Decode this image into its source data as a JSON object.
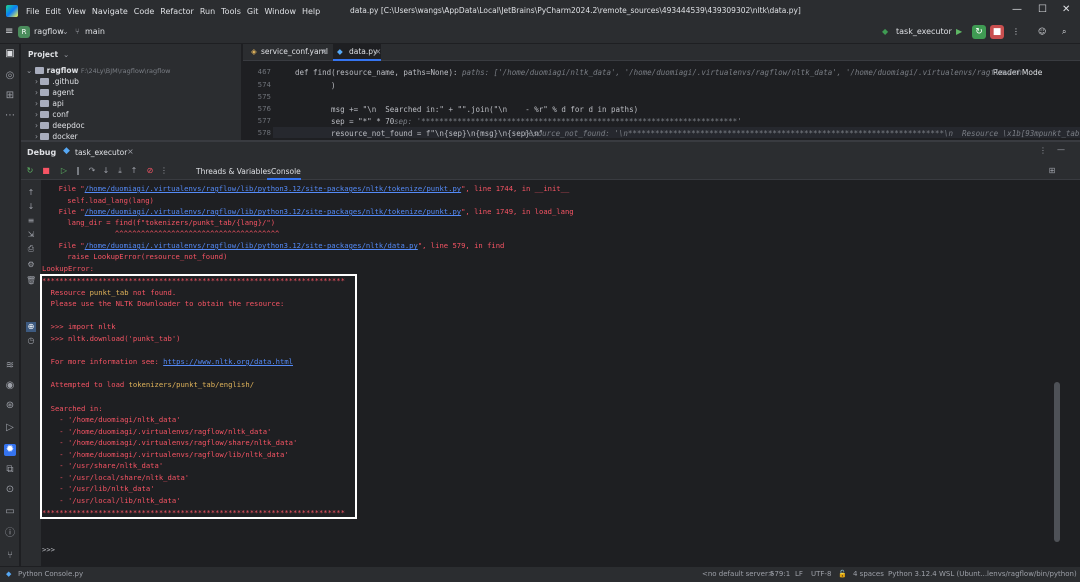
{
  "menu": [
    "File",
    "Edit",
    "View",
    "Navigate",
    "Code",
    "Refactor",
    "Run",
    "Tools",
    "Git",
    "Window",
    "Help"
  ],
  "window_title": "data.py [C:\\Users\\wangs\\AppData\\Local\\JetBrains\\PyCharm2024.2\\remote_sources\\493444539\\439309302\\nltk\\data.py]",
  "toolbar": {
    "project_name": "ragflow",
    "branch": "main",
    "run_config": "task_executor"
  },
  "project_pane": {
    "title": "Project",
    "root": "ragflow",
    "root_path": "F:\\24Ly\\BJM\\ragflow\\ragflow",
    "items": [
      ".github",
      "agent",
      "api",
      "conf",
      "deepdoc",
      "docker"
    ]
  },
  "editor": {
    "tabs": [
      "service_conf.yaml",
      "data.py"
    ],
    "reader_mode": "Reader Mode",
    "lines": [
      {
        "num": "467",
        "code": "def find(resource_name, paths=None):",
        "hint": "  paths: ['/home/duomiagi/nltk_data', '/home/duomiagi/.virtualenvs/ragflow/nltk_data', '/home/duomiagi/.virtualenvs/ragflow/sh"
      },
      {
        "num": "574",
        "code": "    )",
        "hint": ""
      },
      {
        "num": "575",
        "code": "",
        "hint": ""
      },
      {
        "num": "576",
        "code": "    msg += \"\\n  Searched in:\" + \"\".join(\"\\n    - %r\" % d for d in paths)",
        "hint": ""
      },
      {
        "num": "577",
        "code": "    sep = \"*\" * 70",
        "hint": "  sep: '**********************************************************************'"
      },
      {
        "num": "578",
        "code": "    resource_not_found = f\"\\n{sep}\\n{msg}\\n{sep}\\n\"",
        "hint": "  resource_not_found: '\\n**********************************************************************\\n  Resource \\x1b[93mpunkt_tab\\x1b"
      }
    ]
  },
  "debug": {
    "label": "Debug",
    "session": "task_executor",
    "tabs": [
      "Threads & Variables",
      "Console"
    ]
  },
  "console": {
    "trace": [
      {
        "pre": "  File \"",
        "link": "/home/duomiagi/.virtualenvs/ragflow/lib/python3.12/site-packages/nltk/tokenize/punkt.py",
        "post": "\", line 1744, in __init__"
      },
      {
        "pre": "    self.load_lang(lang)",
        "link": "",
        "post": ""
      },
      {
        "pre": "  File \"",
        "link": "/home/duomiagi/.virtualenvs/ragflow/lib/python3.12/site-packages/nltk/tokenize/punkt.py",
        "post": "\", line 1749, in load_lang"
      },
      {
        "pre": "    lang_dir = find(f\"tokenizers/punkt_tab/{lang}/\")",
        "link": "",
        "post": ""
      },
      {
        "pre": "               ^^^^^^^^^^^^^^^^^^^^^^^^^^^^^^^^^^^^^^",
        "link": "",
        "post": ""
      },
      {
        "pre": "  File \"",
        "link": "/home/duomiagi/.virtualenvs/ragflow/lib/python3.12/site-packages/nltk/data.py",
        "post": "\", line 579, in find"
      },
      {
        "pre": "    raise LookupError(resource_not_found)",
        "link": "",
        "post": ""
      },
      {
        "pre": "LookupError:",
        "link": "",
        "post": ""
      }
    ],
    "sep": "**********************************************************************",
    "resource_pre": "  Resource ",
    "resource_name": "punkt_tab",
    "resource_post": " not found.",
    "downloader_msg": "  Please use the NLTK Downloader to obtain the resource:",
    "import_line": "  >>> import nltk",
    "download_line": "  >>> nltk.download('punkt_tab')",
    "info_pre": "  For more information see: ",
    "info_link": "https://www.nltk.org/data.html",
    "attempted_pre": "  Attempted to load ",
    "attempted_path": "tokenizers/punkt_tab/english/",
    "searched_in": "  Searched in:",
    "paths": [
      "    - '/home/duomiagi/nltk_data'",
      "    - '/home/duomiagi/.virtualenvs/ragflow/nltk_data'",
      "    - '/home/duomiagi/.virtualenvs/ragflow/share/nltk_data'",
      "    - '/home/duomiagi/.virtualenvs/ragflow/lib/nltk_data'",
      "    - '/usr/share/nltk_data'",
      "    - '/usr/local/share/nltk_data'",
      "    - '/usr/lib/nltk_data'",
      "    - '/usr/local/lib/nltk_data'"
    ],
    "prompt": ">>>"
  },
  "statusbar": {
    "left": "Python Console.py",
    "server": "<no default server>",
    "position": "579:1",
    "line_sep": "LF",
    "encoding": "UTF-8",
    "indent": "4 spaces",
    "interpreter": "Python 3.12.4 WSL (Ubunt...lenvs/ragflow/bin/python)"
  },
  "colors": {
    "error": "#f75464",
    "link": "#548af7",
    "run_green": "#3f9b53",
    "stop_red": "#c94f4f"
  }
}
